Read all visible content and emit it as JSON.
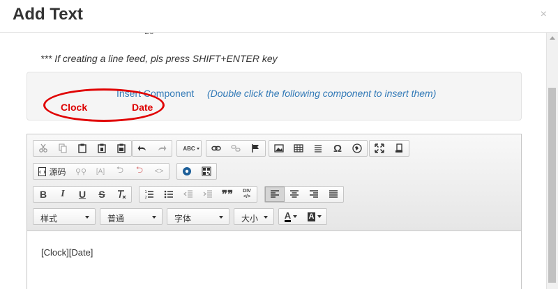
{
  "modal": {
    "title": "Add Text",
    "close": "×",
    "clipped_text": "- 20"
  },
  "note": "*** If creating a line feed, pls press SHIFT+ENTER key",
  "component_panel": {
    "label": "Insert Component",
    "hint": "(Double click the following component to insert them)",
    "items": [
      "Clock",
      "Date"
    ]
  },
  "toolbar": {
    "row1_groups": [
      [
        "cut-icon",
        "copy-icon",
        "paste-icon",
        "paste-text-icon",
        "paste-word-icon"
      ],
      [
        "undo-icon",
        "redo-icon"
      ],
      [
        "spellcheck-icon"
      ],
      [
        "link-icon",
        "unlink-icon",
        "anchor-flag-icon"
      ],
      [
        "image-icon",
        "table-icon",
        "horizontal-line-icon",
        "special-char-icon",
        "iframe-icon"
      ],
      [
        "maximize-icon",
        "show-blocks-icon"
      ]
    ],
    "source_label": "源码",
    "row3_groups": [
      [
        "bold",
        "italic",
        "underline",
        "strike",
        "remove-format"
      ],
      [
        "numbered-list",
        "bulleted-list",
        "outdent",
        "indent",
        "blockquote",
        "div"
      ],
      [
        "align-left",
        "align-center",
        "align-right",
        "justify"
      ]
    ],
    "labels": {
      "bold": "B",
      "italic": "I",
      "underline": "U",
      "strike": "S",
      "ordered_mark": "¹⁄₂",
      "quote_mark": "❞❞",
      "div_mark": "DIV",
      "spell_mark": "ABC",
      "omega": "Ω",
      "text_color": "A",
      "bg_color": "A"
    },
    "combos": {
      "style": "样式",
      "format": "普通",
      "font": "字体",
      "size": "大小"
    }
  },
  "editor": {
    "content": "[Clock][Date]"
  },
  "colors": {
    "accent": "#337ab7",
    "annotation_red": "#e00000",
    "component_red": "#d00000"
  }
}
